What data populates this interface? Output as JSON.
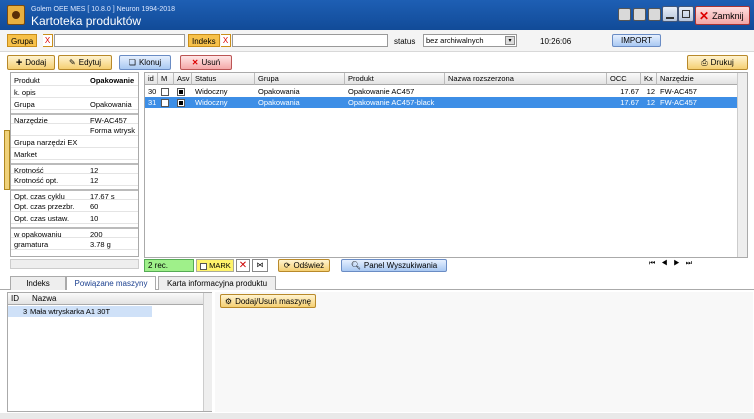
{
  "window": {
    "version": "Golem OEE MES  [ 10.8.0 ]  Neuron 1994-2018",
    "title": "Kartoteka produktów",
    "close_label": "Zamknij"
  },
  "filters": {
    "grupa_label": "Grupa",
    "indeks_label": "Indeks",
    "x": "X",
    "status_label": "status",
    "status_value": "bez archiwalnych",
    "time": "10:26:06",
    "import_label": "IMPORT"
  },
  "toolbar": {
    "add": "Dodaj",
    "edit": "Edytuj",
    "clone": "Klonuj",
    "delete": "Usuń",
    "print": "Drukuj"
  },
  "properties": [
    {
      "key": "Produkt",
      "value": "Opakowanie"
    },
    {
      "key": "k. opis",
      "value": ""
    },
    {
      "key": "Grupa",
      "value": "Opakowania"
    },
    {
      "key": "Narzędzie",
      "value": "FW-AC457",
      "sep": true
    },
    {
      "key": "",
      "value": "Forma wtrysk"
    },
    {
      "key": "Grupa narzędzi EX",
      "value": ""
    },
    {
      "key": "Market",
      "value": ""
    },
    {
      "key": "Krotność",
      "value": "12",
      "sep": true
    },
    {
      "key": "Krotność opt.",
      "value": "12"
    },
    {
      "key": "Opt. czas cyklu",
      "value": "17.67 s",
      "sep": true
    },
    {
      "key": "Opt. czas przezbr.",
      "value": "60"
    },
    {
      "key": "Opt. czas ustaw.",
      "value": "10"
    },
    {
      "key": "w opakowaniu",
      "value": "200",
      "sep": true
    },
    {
      "key": "gramatura",
      "value": "3.78 g"
    }
  ],
  "grid": {
    "columns": [
      "id",
      "M",
      "Asv",
      "Status",
      "Grupa",
      "Produkt",
      "Nazwa rozszerzona",
      "OCC",
      "Kx",
      "Narzędzie"
    ],
    "rows": [
      {
        "id": "30",
        "m": false,
        "asv": true,
        "status": "Widoczny",
        "grupa": "Opakowania",
        "produkt": "Opakowanie AC457",
        "nazwa": "",
        "occ": "17.67",
        "kx": "12",
        "narzedzie": "FW-AC457",
        "selected": false
      },
      {
        "id": "31",
        "m": false,
        "asv": true,
        "status": "Widoczny",
        "grupa": "Opakowania",
        "produkt": "Opakowanie AC457-black",
        "nazwa": "",
        "occ": "17.67",
        "kx": "12",
        "narzedzie": "FW-AC457",
        "selected": true
      }
    ]
  },
  "footer": {
    "count": "2 rec.",
    "mark": "MARK",
    "refresh": "Odśwież",
    "search_panel": "Panel Wyszukiwania"
  },
  "tabs": [
    "Indeks",
    "Powiązane maszyny",
    "Karta informacyjna produktu"
  ],
  "machines": {
    "columns": [
      "ID",
      "Nazwa"
    ],
    "rows": [
      {
        "id": "3",
        "name": "Mała wtryskarka A1 30T"
      }
    ],
    "add_remove_label": "Dodaj/Usuń maszynę"
  },
  "colors": {
    "title_bg": "#1a57a8",
    "selection": "#3d8ee6",
    "orange": "#f5cf72",
    "mark_yellow": "#fff36a"
  }
}
